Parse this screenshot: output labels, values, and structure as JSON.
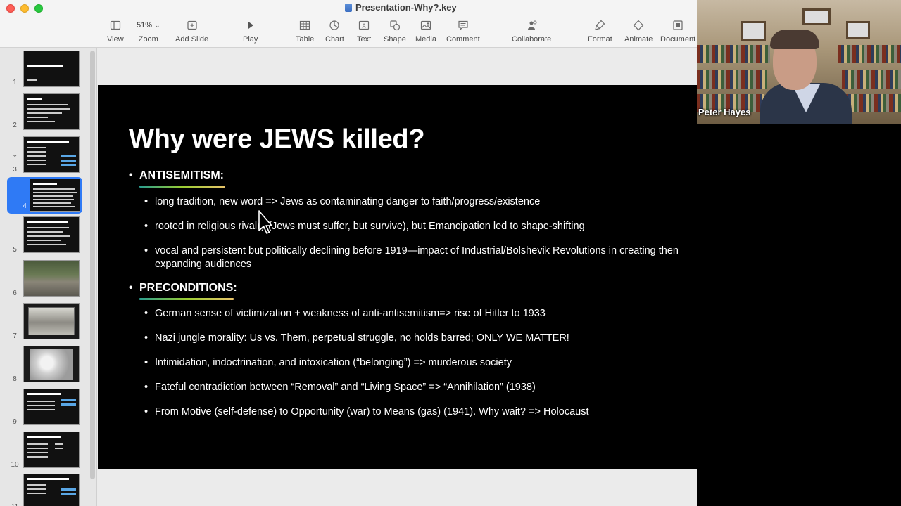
{
  "window": {
    "title": "Presentation-Why?.key"
  },
  "toolbar": {
    "view_label": "View",
    "zoom_value": "51%",
    "zoom_label": "Zoom",
    "add_slide_label": "Add Slide",
    "play_label": "Play",
    "table_label": "Table",
    "chart_label": "Chart",
    "text_label": "Text",
    "shape_label": "Shape",
    "media_label": "Media",
    "comment_label": "Comment",
    "collaborate_label": "Collaborate",
    "format_label": "Format",
    "animate_label": "Animate",
    "document_label": "Document"
  },
  "navigator": {
    "selected_slide": 4,
    "slides": [
      {
        "number": "1",
        "title": "WHY? Explaining the Holocaust"
      },
      {
        "number": "2",
        "title": "Introduction"
      },
      {
        "number": "3",
        "title": "Differing Death Rates Among Victim Groups"
      },
      {
        "number": "4",
        "title": "Why were JEWS killed?"
      },
      {
        "number": "5",
        "title": "Why didn't anyone prevent or stop it?"
      },
      {
        "number": "6",
        "title": ""
      },
      {
        "number": "7",
        "title": ""
      },
      {
        "number": "8",
        "title": ""
      },
      {
        "number": "9",
        "title": "The Pace and Intensity of Murder"
      },
      {
        "number": "10",
        "title": "The Pace and Intensity of Murder"
      },
      {
        "number": "11",
        "title": "Differing Death Rates Among Victim Groups"
      }
    ]
  },
  "slide": {
    "title": "Why were JEWS killed?",
    "bullet_char": "•",
    "sections": [
      {
        "heading": "ANTISEMITISM:",
        "bullets": [
          "long tradition, new word => Jews as contaminating danger to faith/progress/existence",
          "rooted in religious rivalry (Jews must suffer, but survive), but Emancipation led to shape-shifting",
          "vocal and persistent but politically declining before 1919—impact of Industrial/Bolshevik Revolutions in creating then expanding audiences"
        ]
      },
      {
        "heading": "PRECONDITIONS:",
        "bullets": [
          "German sense of victimization + weakness of anti-antisemitism=> rise of Hitler to 1933",
          "Nazi jungle morality: Us vs. Them, perpetual struggle, no holds barred; ONLY WE MATTER!",
          "Intimidation, indoctrination, and intoxication (“belonging”) => murderous society",
          "Fateful contradiction between “Removal” and “Living Space” => “Annihilation” (1938)",
          "From Motive (self-defense) to Opportunity (war) to Means (gas) (1941).  Why wait? => Holocaust"
        ]
      }
    ]
  },
  "video": {
    "participant_name": "Peter Hayes"
  }
}
